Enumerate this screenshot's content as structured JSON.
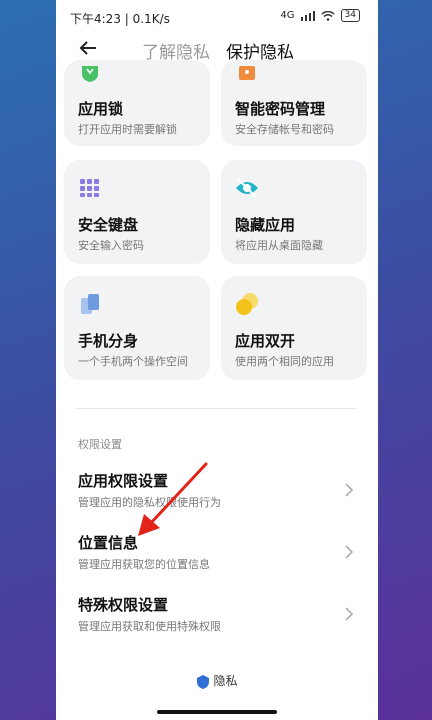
{
  "status_bar": {
    "time": "下午4:23 | 0.1K/s",
    "signal": "4G",
    "battery": "34"
  },
  "nav": {
    "tab_inactive": "了解隐私",
    "tab_active": "保护隐私"
  },
  "cards": [
    {
      "title": "应用锁",
      "subtitle": "打开应用时需要解锁",
      "icon": "lock-icon"
    },
    {
      "title": "智能密码管理",
      "subtitle": "安全存储帐号和密码",
      "icon": "password-icon"
    },
    {
      "title": "安全键盘",
      "subtitle": "安全输入密码",
      "icon": "keyboard-icon"
    },
    {
      "title": "隐藏应用",
      "subtitle": "将应用从桌面隐藏",
      "icon": "eye-off-icon"
    },
    {
      "title": "手机分身",
      "subtitle": "一个手机两个操作空间",
      "icon": "dual-space-icon"
    },
    {
      "title": "应用双开",
      "subtitle": "使用两个相同的应用",
      "icon": "dual-app-icon"
    }
  ],
  "permissions": {
    "section_label": "权限设置",
    "items": [
      {
        "title": "应用权限设置",
        "subtitle": "管理应用的隐私权限使用行为"
      },
      {
        "title": "位置信息",
        "subtitle": "管理应用获取您的位置信息"
      },
      {
        "title": "特殊权限设置",
        "subtitle": "管理应用获取和使用特殊权限"
      }
    ]
  },
  "footer": {
    "label": "隐私"
  },
  "colors": {
    "green": "#49c267",
    "orange": "#f08a3c",
    "purple": "#8b7ae0",
    "teal": "#24b5c8",
    "blue": "#6f9be0",
    "yellow": "#f4c21b",
    "arrow": "#e2231a"
  }
}
